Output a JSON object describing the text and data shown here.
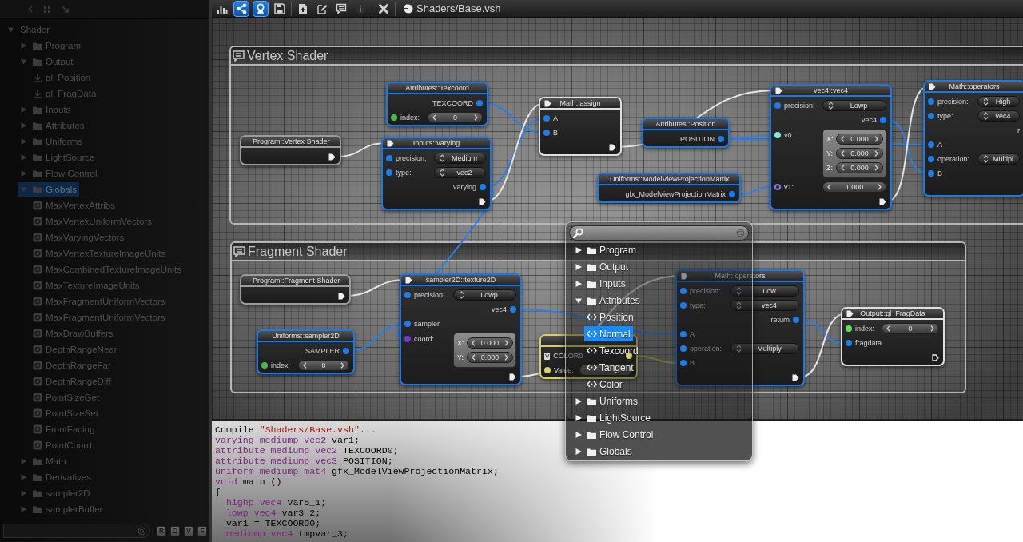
{
  "sidebar": {
    "tree": [
      {
        "label": "Shader",
        "kind": "group",
        "expanded": true,
        "selected": false,
        "children": [
          {
            "label": "Program",
            "kind": "folder",
            "expanded": false,
            "selected": false
          },
          {
            "label": "Output",
            "kind": "folder",
            "expanded": true,
            "selected": false,
            "children": [
              {
                "label": "gl_Position",
                "kind": "output",
                "selected": false
              },
              {
                "label": "gl_FragData",
                "kind": "output",
                "selected": false
              }
            ]
          },
          {
            "label": "Inputs",
            "kind": "folder",
            "expanded": false,
            "selected": false
          },
          {
            "label": "Attributes",
            "kind": "folder",
            "expanded": false,
            "selected": false
          },
          {
            "label": "Uniforms",
            "kind": "folder",
            "expanded": false,
            "selected": false
          },
          {
            "label": "LightSource",
            "kind": "folder",
            "expanded": false,
            "selected": false
          },
          {
            "label": "Flow Control",
            "kind": "folder",
            "expanded": false,
            "selected": false
          },
          {
            "label": "Globals",
            "kind": "folder",
            "expanded": true,
            "selected": true,
            "children": [
              {
                "label": "MaxVertexAttribs",
                "kind": "constant",
                "selected": false
              },
              {
                "label": "MaxVertexUniformVectors",
                "kind": "constant",
                "selected": false
              },
              {
                "label": "MaxVaryingVectors",
                "kind": "constant",
                "selected": false
              },
              {
                "label": "MaxVertexTextureImageUnits",
                "kind": "constant",
                "selected": false
              },
              {
                "label": "MaxCombinedTextureImageUnits",
                "kind": "constant",
                "selected": false
              },
              {
                "label": "MaxTextureImageUnits",
                "kind": "constant",
                "selected": false
              },
              {
                "label": "MaxFragmentUniformVectors",
                "kind": "constant",
                "selected": false
              },
              {
                "label": "MaxFragmentUniformVectors",
                "kind": "constant",
                "selected": false
              },
              {
                "label": "MaxDrawBuffers",
                "kind": "constant",
                "selected": false
              },
              {
                "label": "DepthRangeNear",
                "kind": "constant",
                "selected": false
              },
              {
                "label": "DepthRangeFar",
                "kind": "constant",
                "selected": false
              },
              {
                "label": "DepthRangeDiff",
                "kind": "constant",
                "selected": false
              },
              {
                "label": "PointSizeGet",
                "kind": "constant",
                "selected": false
              },
              {
                "label": "PointSizeSet",
                "kind": "constant",
                "selected": false
              },
              {
                "label": "FrontFacing",
                "kind": "constant",
                "selected": false
              },
              {
                "label": "PointCoord",
                "kind": "constant",
                "selected": false
              }
            ]
          },
          {
            "label": "Math",
            "kind": "folder",
            "expanded": false,
            "selected": false
          },
          {
            "label": "Derivatives",
            "kind": "folder",
            "expanded": false,
            "selected": false
          },
          {
            "label": "sampler2D",
            "kind": "folder",
            "expanded": false,
            "selected": false
          },
          {
            "label": "samplerBuffer",
            "kind": "folder",
            "expanded": false,
            "selected": false
          }
        ]
      }
    ],
    "filters": [
      {
        "label": "R"
      },
      {
        "label": "O"
      },
      {
        "label": "V"
      },
      {
        "label": "F"
      }
    ]
  },
  "toolbar": {
    "groups": [
      {
        "buttons": [
          {
            "kind": "stats",
            "selected": false,
            "disabled": false
          },
          {
            "kind": "share",
            "selected": true,
            "disabled": false
          },
          {
            "kind": "award",
            "selected": true,
            "disabled": false
          },
          {
            "kind": "save",
            "selected": false,
            "disabled": false
          }
        ]
      },
      {
        "buttons": [
          {
            "kind": "new",
            "selected": false,
            "disabled": false
          },
          {
            "kind": "edit",
            "selected": false,
            "disabled": false
          },
          {
            "kind": "comment",
            "selected": false,
            "disabled": false
          },
          {
            "kind": "info",
            "selected": false,
            "disabled": true
          }
        ]
      },
      {
        "buttons": [
          {
            "kind": "close",
            "selected": false,
            "disabled": false
          }
        ]
      }
    ],
    "document": {
      "title": "Shaders/Base.vsh"
    }
  },
  "canvas": {
    "groups": [
      {
        "title": "Vertex Shader",
        "nodes": [
          {
            "title": "Program::Vertex Shader",
            "color": "#9c9c9c",
            "exec_in": false,
            "exec_out": true,
            "exec_outline": false
          },
          {
            "title": "Attributes::Texcoord",
            "color": "#1d78e6",
            "exec_in": false,
            "exec_out": false,
            "rows": [
              {
                "kind": "output",
                "label": "TEXCOORD",
                "port": {
                  "color": "#1e7ce8",
                  "hollow": false
                }
              },
              {
                "kind": "spinner",
                "label": "index:",
                "value": "0",
                "port": {
                  "color": "#4cb84c",
                  "hollow": false
                }
              }
            ]
          },
          {
            "title": "Inputs::varying",
            "color": "#1d78e6",
            "exec_in": true,
            "exec_out": true,
            "exec_outline": false,
            "rows": [
              {
                "kind": "dropdown",
                "label": "precision:",
                "value": "Medium",
                "port": {
                  "color": "#1e7ce8",
                  "hollow": false
                }
              },
              {
                "kind": "dropdown",
                "label": "type:",
                "value": "vec2",
                "port": {
                  "color": "#1e7ce8",
                  "hollow": false
                }
              },
              {
                "kind": "output",
                "label": "varying",
                "port": {
                  "color": "#1e7ce8",
                  "hollow": false
                }
              }
            ]
          },
          {
            "title": "Math::assign",
            "color": "#e0e0e0",
            "exec_in": true,
            "exec_out": true,
            "exec_outline": false,
            "rows": [
              {
                "kind": "input",
                "label": "A",
                "port": {
                  "color": "#1e7ce8",
                  "hollow": false
                }
              },
              {
                "kind": "input",
                "label": "B",
                "port": {
                  "color": "#1e7ce8",
                  "hollow": false
                }
              }
            ]
          },
          {
            "title": "Attributes::Position",
            "color": "#1d78e6",
            "exec_in": false,
            "exec_out": false,
            "rows": [
              {
                "kind": "output",
                "label": "POSITION",
                "port": {
                  "color": "#1e7ce8",
                  "hollow": false
                }
              }
            ]
          },
          {
            "title": "Uniforms::ModelViewProjectionMatrix",
            "color": "#1d78e6",
            "exec_in": false,
            "exec_out": false,
            "rows": [
              {
                "kind": "output",
                "label": "gfx_ModelViewProjectionMatrix",
                "port": {
                  "color": "#1e7ce8",
                  "hollow": false
                }
              }
            ]
          },
          {
            "title": "vec4::vec4",
            "color": "#1d78e6",
            "exec_in": true,
            "exec_out": true,
            "exec_outline": false,
            "rows": [
              {
                "kind": "dropdown",
                "label": "precision:",
                "value": "Lowp",
                "port": {
                  "color": "#1e7ce8",
                  "hollow": false
                }
              },
              {
                "kind": "output",
                "label": "vec4",
                "port": {
                  "color": "#1e7ce8",
                  "hollow": false
                }
              },
              {
                "kind": "vector",
                "label": "v0:",
                "port": {
                  "color": "#7ee8ea",
                  "hollow": false
                },
                "components": [
                  {
                    "axis": "X:",
                    "value": "0.000"
                  },
                  {
                    "axis": "Y:",
                    "value": "0.000"
                  },
                  {
                    "axis": "Z:",
                    "value": "0.000"
                  }
                ]
              },
              {
                "kind": "spinner",
                "label": "v1:",
                "value": "1.000",
                "port": {
                  "color": "#8a78e0",
                  "hollow": true
                }
              }
            ]
          },
          {
            "title": "Math::operators",
            "color": "#1d78e6",
            "exec_in": true,
            "exec_out": false,
            "rows": [
              {
                "kind": "dropdown",
                "label": "precision:",
                "value": "High",
                "port": {
                  "color": "#1e7ce8",
                  "hollow": false
                }
              },
              {
                "kind": "dropdown",
                "label": "type:",
                "value": "vec4",
                "port": {
                  "color": "#1e7ce8",
                  "hollow": false
                }
              },
              {
                "kind": "output",
                "label": "r"
              },
              {
                "kind": "input",
                "label": "A",
                "port": {
                  "color": "#1e7ce8",
                  "hollow": false
                }
              },
              {
                "kind": "dropdown",
                "label": "operation:",
                "value": "Multipl",
                "port": {
                  "color": "#1e7ce8",
                  "hollow": false
                }
              },
              {
                "kind": "input",
                "label": "B",
                "port": {
                  "color": "#1e7ce8",
                  "hollow": false
                }
              }
            ]
          }
        ]
      },
      {
        "title": "Fragment Shader",
        "nodes": [
          {
            "title": "Program::Fragment Shader",
            "color": "#9c9c9c",
            "exec_in": false,
            "exec_out": true,
            "exec_outline": false
          },
          {
            "title": "Uniforms::sampler2D",
            "color": "#1d78e6",
            "exec_in": false,
            "exec_out": false,
            "rows": [
              {
                "kind": "output",
                "label": "SAMPLER",
                "port": {
                  "color": "#1e7ce8",
                  "hollow": false
                }
              },
              {
                "kind": "spinner",
                "label": "index:",
                "value": "0",
                "port": {
                  "color": "#4cb84c",
                  "hollow": false
                }
              }
            ]
          },
          {
            "title": "sampler2D::texture2D",
            "color": "#1d78e6",
            "exec_in": true,
            "exec_out": true,
            "exec_outline": false,
            "rows": [
              {
                "kind": "dropdown",
                "label": "precision:",
                "value": "Lowp",
                "port": {
                  "color": "#1e7ce8",
                  "hollow": false
                }
              },
              {
                "kind": "output",
                "label": "vec4",
                "port": {
                  "color": "#1e7ce8",
                  "hollow": false
                }
              },
              {
                "kind": "input",
                "label": "sampler",
                "port": {
                  "color": "#1e7ce8",
                  "hollow": false
                }
              },
              {
                "kind": "vector",
                "label": "coord:",
                "port": {
                  "color": "#6a3fd0",
                  "hollow": false
                },
                "components": [
                  {
                    "axis": "X:",
                    "value": "0.000"
                  },
                  {
                    "axis": "Y:",
                    "value": "0.000"
                  }
                ]
              }
            ]
          },
          {
            "color": "#d8d060",
            "exec_in": false,
            "exec_out": false,
            "rows": [
              {
                "kind": "tagged_output",
                "tag": "V",
                "label": "COLOR0",
                "port": {
                  "color": "#d8d46a",
                  "hollow": false
                }
              },
              {
                "kind": "field",
                "label": "Value:",
                "port": {
                  "color": "#d8d46a",
                  "hollow": false
                }
              }
            ]
          },
          {
            "title": "Math::operators",
            "color": "#1d78e6",
            "exec_in": true,
            "exec_out": true,
            "exec_outline": false,
            "rows": [
              {
                "kind": "dropdown",
                "label": "precision:",
                "value": "Low",
                "port": {
                  "color": "#1e7ce8",
                  "hollow": false
                }
              },
              {
                "kind": "dropdown",
                "label": "type:",
                "value": "vec4",
                "port": {
                  "color": "#1e7ce8",
                  "hollow": false
                }
              },
              {
                "kind": "output",
                "label": "return",
                "port": {
                  "color": "#1e7ce8",
                  "hollow": false
                }
              },
              {
                "kind": "input",
                "label": "A",
                "port": {
                  "color": "#1e7ce8",
                  "hollow": false
                }
              },
              {
                "kind": "dropdown",
                "label": "operation:",
                "value": "Multiply",
                "port": {
                  "color": "#1e7ce8",
                  "hollow": false
                }
              },
              {
                "kind": "input",
                "label": "B",
                "port": {
                  "color": "#1e7ce8",
                  "hollow": false
                }
              }
            ]
          },
          {
            "title": "Output::gl_FragData",
            "color": "#e0e0e0",
            "exec_in": true,
            "exec_out": true,
            "exec_outline": true,
            "rows": [
              {
                "kind": "spinner",
                "label": "index:",
                "value": "0",
                "port": {
                  "color": "#63e05a",
                  "hollow": false
                }
              },
              {
                "kind": "input",
                "label": "fragdata",
                "port": {
                  "color": "#1e7ce8",
                  "hollow": false
                }
              }
            ]
          }
        ]
      }
    ]
  },
  "menu": {
    "items": [
      {
        "label": "Program",
        "kind": "folder",
        "expanded": false,
        "selected": false
      },
      {
        "label": "Output",
        "kind": "folder",
        "expanded": false,
        "selected": false
      },
      {
        "label": "Inputs",
        "kind": "folder",
        "expanded": false,
        "selected": false
      },
      {
        "label": "Attributes",
        "kind": "folder",
        "expanded": true,
        "selected": false,
        "children": [
          {
            "label": "Position",
            "kind": "attribute",
            "selected": false
          },
          {
            "label": "Normal",
            "kind": "attribute",
            "selected": true
          },
          {
            "label": "Texcoord",
            "kind": "attribute",
            "selected": false
          },
          {
            "label": "Tangent",
            "kind": "attribute",
            "selected": false
          },
          {
            "label": "Color",
            "kind": "attribute",
            "selected": false
          }
        ]
      },
      {
        "label": "Uniforms",
        "kind": "folder",
        "expanded": false,
        "selected": false
      },
      {
        "label": "LightSource",
        "kind": "folder",
        "expanded": false,
        "selected": false
      },
      {
        "label": "Flow Control",
        "kind": "folder",
        "expanded": false,
        "selected": false
      },
      {
        "label": "Globals",
        "kind": "folder",
        "expanded": false,
        "selected": false
      }
    ]
  },
  "console": {
    "lines": [
      {
        "tokens": [
          {
            "kind": "plain",
            "text": "Compile "
          },
          {
            "kind": "string",
            "text": "\"Shaders/Base.vsh\""
          },
          {
            "kind": "plain",
            "text": "..."
          }
        ]
      },
      {
        "tokens": [
          {
            "kind": "keyword",
            "text": "varying mediump vec2"
          },
          {
            "kind": "plain",
            "text": " var1;"
          }
        ]
      },
      {
        "tokens": [
          {
            "kind": "keyword",
            "text": "attribute mediump vec2"
          },
          {
            "kind": "plain",
            "text": " TEXCOORD0;"
          }
        ]
      },
      {
        "tokens": [
          {
            "kind": "keyword",
            "text": "attribute mediump vec3"
          },
          {
            "kind": "plain",
            "text": " POSITION;"
          }
        ]
      },
      {
        "tokens": [
          {
            "kind": "keyword",
            "text": "uniform mediump mat4"
          },
          {
            "kind": "plain",
            "text": " gfx_ModelViewProjectionMatrix;"
          }
        ]
      },
      {
        "tokens": [
          {
            "kind": "keyword",
            "text": "void"
          },
          {
            "kind": "plain",
            "text": " main ()"
          }
        ]
      },
      {
        "tokens": [
          {
            "kind": "plain",
            "text": "{"
          }
        ]
      },
      {
        "tokens": [
          {
            "kind": "keyword",
            "text": "  highp vec4"
          },
          {
            "kind": "plain",
            "text": " var5_1;"
          }
        ]
      },
      {
        "tokens": [
          {
            "kind": "keyword",
            "text": "  lowp vec4"
          },
          {
            "kind": "plain",
            "text": " var3_2;"
          }
        ]
      },
      {
        "tokens": [
          {
            "kind": "plain",
            "text": "  var1 = TEXCOORD0;"
          }
        ]
      },
      {
        "tokens": [
          {
            "kind": "keyword",
            "text": "  mediump vec4"
          },
          {
            "kind": "plain",
            "text": " tmpvar_3;"
          }
        ]
      }
    ]
  }
}
